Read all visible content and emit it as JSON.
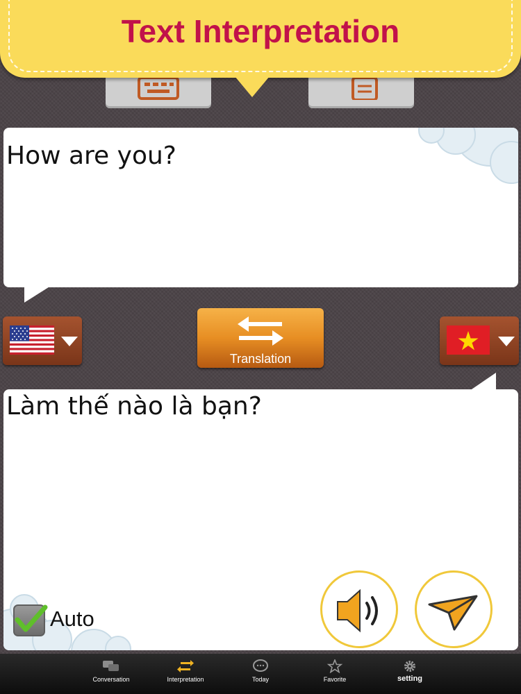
{
  "header": {
    "title": "Text Interpretation"
  },
  "mode_buttons": [
    {
      "name": "keyboard-input",
      "icon": "keyboard-icon"
    },
    {
      "name": "clipboard-input",
      "icon": "clipboard-icon"
    }
  ],
  "input": {
    "text": "How are you?"
  },
  "source_language": {
    "flag": "us-flag-icon"
  },
  "target_language": {
    "flag": "vietnam-flag-icon"
  },
  "translate_button": {
    "label": "Translation",
    "icon": "swap-arrows-icon"
  },
  "output": {
    "text": "Làm thế nào là bạn?"
  },
  "auto": {
    "label": "Auto",
    "checked": true
  },
  "actions": [
    {
      "icon": "speaker-icon"
    },
    {
      "icon": "send-icon"
    }
  ],
  "tabs": [
    {
      "label": "Conversation",
      "icon": "chat-bubbles-icon"
    },
    {
      "label": "Interpretation",
      "icon": "swap-icon",
      "active": true
    },
    {
      "label": "Today",
      "icon": "speech-bubble-icon"
    },
    {
      "label": "Favorite",
      "icon": "star-icon"
    },
    {
      "label": "setting",
      "icon": "gear-icon"
    }
  ],
  "colors": {
    "banner": "#fadb5a",
    "title": "#c1124a",
    "accent": "#e78e23",
    "tab_active": "#f0b323"
  }
}
